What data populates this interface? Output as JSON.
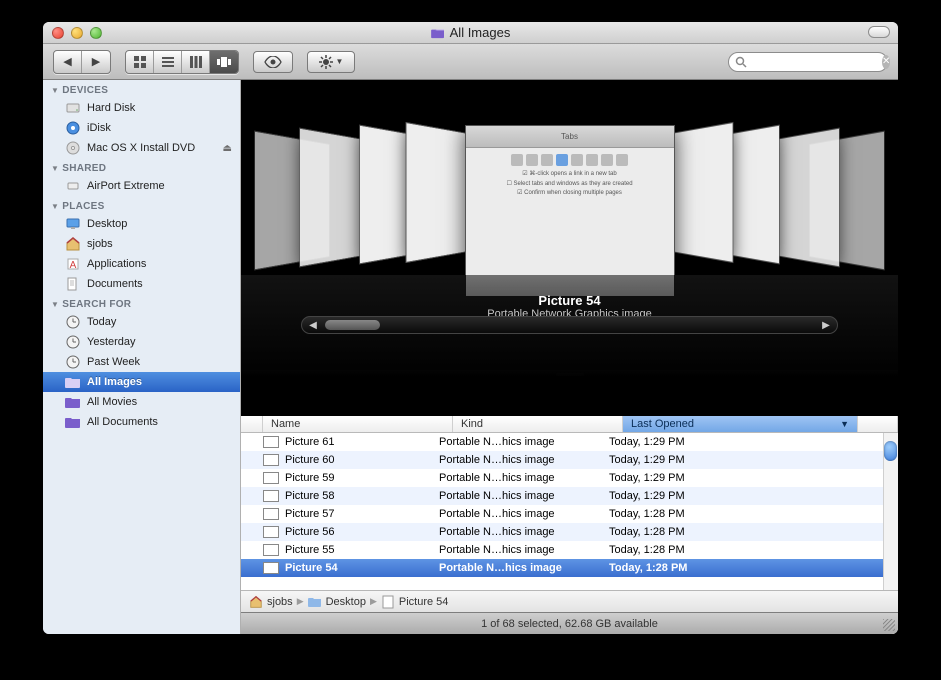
{
  "window": {
    "title": "All Images"
  },
  "toolbar": {
    "view_modes": [
      "icon",
      "list",
      "column",
      "coverflow"
    ],
    "active_view_index": 3,
    "search_placeholder": ""
  },
  "sidebar": {
    "sections": [
      {
        "title": "DEVICES",
        "items": [
          {
            "label": "Hard Disk",
            "icon": "hdd"
          },
          {
            "label": "iDisk",
            "icon": "idisk"
          },
          {
            "label": "Mac OS X Install DVD",
            "icon": "dvd",
            "eject": true
          }
        ]
      },
      {
        "title": "SHARED",
        "items": [
          {
            "label": "AirPort Extreme",
            "icon": "airport"
          }
        ]
      },
      {
        "title": "PLACES",
        "items": [
          {
            "label": "Desktop",
            "icon": "desktop"
          },
          {
            "label": "sjobs",
            "icon": "home"
          },
          {
            "label": "Applications",
            "icon": "apps"
          },
          {
            "label": "Documents",
            "icon": "docs"
          }
        ]
      },
      {
        "title": "SEARCH FOR",
        "items": [
          {
            "label": "Today",
            "icon": "clock"
          },
          {
            "label": "Yesterday",
            "icon": "clock"
          },
          {
            "label": "Past Week",
            "icon": "clock"
          },
          {
            "label": "All Images",
            "icon": "smart",
            "selected": true
          },
          {
            "label": "All Movies",
            "icon": "smart"
          },
          {
            "label": "All Documents",
            "icon": "smart"
          }
        ]
      }
    ]
  },
  "coverflow": {
    "center_title": "Picture 54",
    "center_subtitle": "Portable Network Graphics image"
  },
  "columns": {
    "name": "Name",
    "kind": "Kind",
    "last_opened": "Last Opened",
    "sort_column": "last_opened",
    "sort_dir": "desc"
  },
  "rows": [
    {
      "name": "Picture 61",
      "kind": "Portable N…hics image",
      "last": "Today, 1:29 PM"
    },
    {
      "name": "Picture 60",
      "kind": "Portable N…hics image",
      "last": "Today, 1:29 PM"
    },
    {
      "name": "Picture 59",
      "kind": "Portable N…hics image",
      "last": "Today, 1:29 PM"
    },
    {
      "name": "Picture 58",
      "kind": "Portable N…hics image",
      "last": "Today, 1:29 PM"
    },
    {
      "name": "Picture 57",
      "kind": "Portable N…hics image",
      "last": "Today, 1:28 PM"
    },
    {
      "name": "Picture 56",
      "kind": "Portable N…hics image",
      "last": "Today, 1:28 PM"
    },
    {
      "name": "Picture 55",
      "kind": "Portable N…hics image",
      "last": "Today, 1:28 PM"
    },
    {
      "name": "Picture 54",
      "kind": "Portable N…hics image",
      "last": "Today, 1:28 PM",
      "selected": true
    }
  ],
  "pathbar": [
    {
      "label": "sjobs",
      "icon": "home"
    },
    {
      "label": "Desktop",
      "icon": "folder"
    },
    {
      "label": "Picture 54",
      "icon": "file"
    }
  ],
  "status": {
    "text": "1 of 68 selected, 62.68 GB available"
  }
}
